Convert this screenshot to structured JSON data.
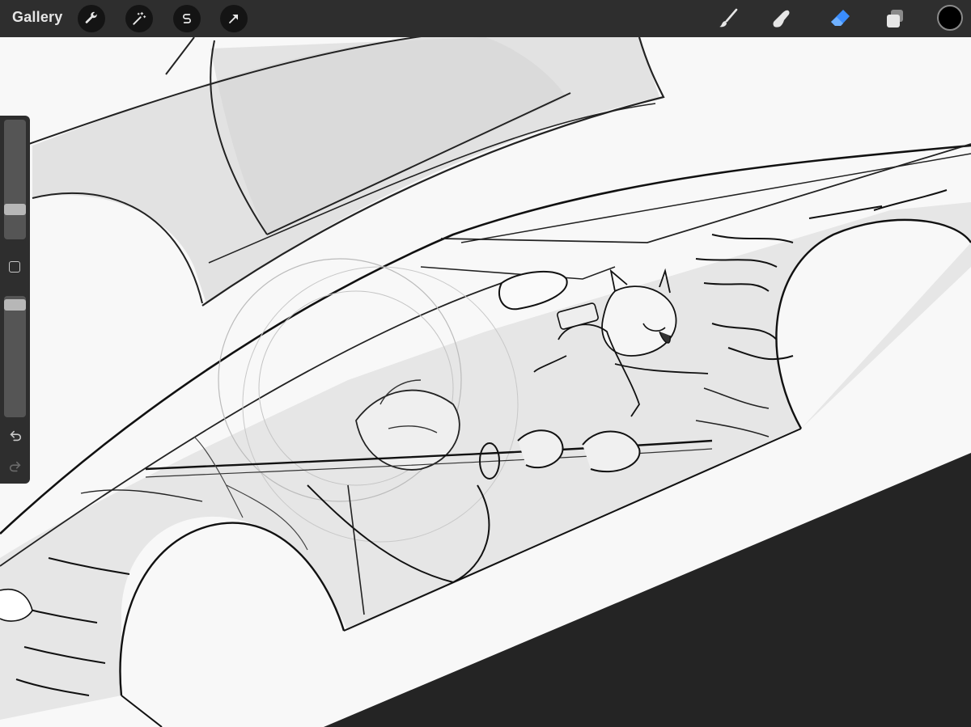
{
  "app": {
    "gallery_label": "Gallery"
  },
  "toolbar_left": [
    {
      "name": "actions-button",
      "icon": "wrench-icon"
    },
    {
      "name": "adjustments-button",
      "icon": "magic-wand-icon"
    },
    {
      "name": "selection-button",
      "icon": "selection-s-icon"
    },
    {
      "name": "transform-button",
      "icon": "arrow-cursor-icon"
    }
  ],
  "toolbar_right": [
    {
      "name": "brush-tool",
      "icon": "paintbrush-icon",
      "active": false
    },
    {
      "name": "smudge-tool",
      "icon": "smudge-finger-icon",
      "active": false
    },
    {
      "name": "eraser-tool",
      "icon": "eraser-icon",
      "active": true
    },
    {
      "name": "layers-button",
      "icon": "layers-icon",
      "active": false
    }
  ],
  "colors": {
    "toolbar_bg": "#2e2e2e",
    "active_tool": "#3a8dff",
    "current_color": "#000000",
    "canvas_bg": "#f8f8f8",
    "outside_canvas": "#242424"
  },
  "sidebar": {
    "brush_size_level": 0.74,
    "opacity_level": 0.95
  }
}
